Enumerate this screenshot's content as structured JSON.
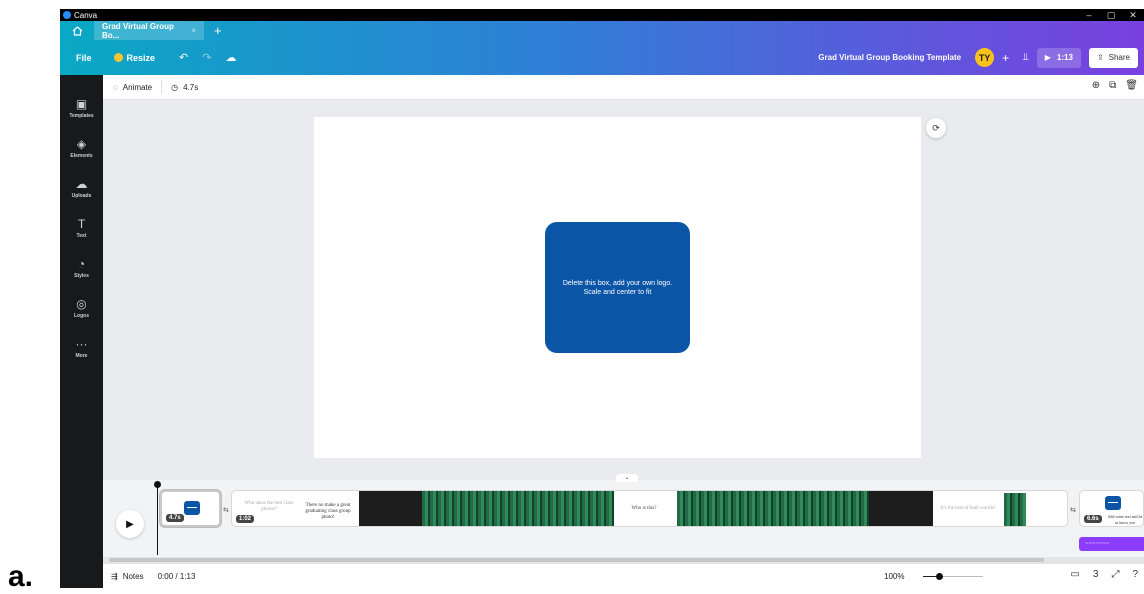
{
  "outer_label": "a.",
  "window": {
    "app_name": "Canva",
    "controls": [
      "–",
      "▢",
      "✕"
    ]
  },
  "tabs": {
    "home_icon": "home-icon",
    "active_tab": "Grad Virtual Group Bo...",
    "close_glyph": "×",
    "new_tab_glyph": "+"
  },
  "toolbar": {
    "file_label": "File",
    "resize_label": "Resize",
    "undo_glyph": "↶",
    "redo_glyph": "↷",
    "cloud_glyph": "☁",
    "doc_title": "Grad Virtual Group Booking Template",
    "avatar_initials": "TY",
    "add_glyph": "+",
    "insights_glyph": "⫫",
    "play_glyph": "▶",
    "play_time": "1:13",
    "share_glyph": "⇪",
    "share_label": "Share"
  },
  "sidebar": {
    "items": [
      {
        "label": "Templates",
        "icon": "▣"
      },
      {
        "label": "Elements",
        "icon": "◈"
      },
      {
        "label": "Uploads",
        "icon": "☁"
      },
      {
        "label": "Text",
        "icon": "T"
      },
      {
        "label": "Styles",
        "icon": "◔"
      },
      {
        "label": "Logos",
        "icon": "◎"
      },
      {
        "label": "More",
        "icon": "···"
      }
    ]
  },
  "subbar": {
    "animate_glyph": "◌",
    "animate_label": "Animate",
    "duration_glyph": "◷",
    "duration_label": "4.7s",
    "right_icons": [
      "⊕",
      "⧉",
      "🗑"
    ]
  },
  "canvas": {
    "logo_box_line1": "Delete this box, add your own logo.",
    "logo_box_line2": "Scale and center to fit",
    "comment_glyph": "⟳",
    "accent_color": "#0b55a6"
  },
  "timeline": {
    "play_glyph": "▶",
    "collapse_glyph": "⌄",
    "clip1_duration": "4.7s",
    "clip2_duration": "1:02",
    "clip2_text1": "Who takes the best class photos?",
    "clip2_text2": "There no make a great graduating class group photo!",
    "clip2_text3": "Who is this?",
    "clip2_text4": "It's the best of both worlds!",
    "clip3_duration": "6.6s",
    "clip3_text": "Add some text and let us know you",
    "audio_label": "~~~~~~~",
    "transition_glyph": "⇆"
  },
  "footer": {
    "notes_glyph": "⇶",
    "notes_label": "Notes",
    "time": "0:00 / 1:13",
    "zoom": "100%",
    "icons": [
      "▭",
      "3",
      "⤢",
      "?"
    ]
  }
}
